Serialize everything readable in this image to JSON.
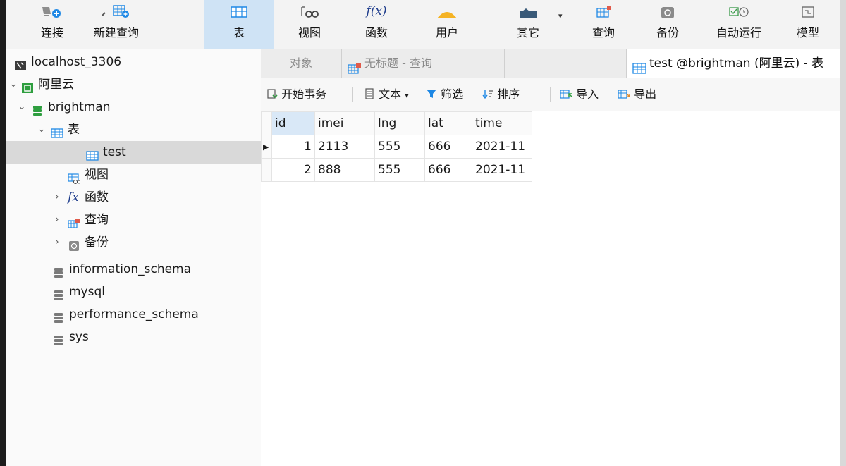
{
  "toolbar": {
    "connect": "连接",
    "new_query": "新建查询",
    "table": "表",
    "view": "视图",
    "function": "函数",
    "user": "用户",
    "others": "其它",
    "query": "查询",
    "backup": "备份",
    "auto_run": "自动运行",
    "model": "模型",
    "function_icon_text": "f(x)",
    "active_item": "table"
  },
  "sidebar": {
    "connection": "localhost_3306",
    "aliyun": "阿里云",
    "database": "brightman",
    "tables_folder": "表",
    "table_test": "test",
    "views": "视图",
    "functions": "函数",
    "function_icon_text": "fx",
    "queries": "查询",
    "backups": "备份",
    "other_dbs": [
      "information_schema",
      "mysql",
      "performance_schema",
      "sys"
    ]
  },
  "tabs": {
    "objects": "对象",
    "untitled_query": "无标题 - 查询",
    "active": "test @brightman (阿里云) - 表"
  },
  "subtoolbar": {
    "begin_transaction": "开始事务",
    "text": "文本",
    "filter": "筛选",
    "sort": "排序",
    "import": "导入",
    "export": "导出"
  },
  "grid": {
    "columns": [
      "id",
      "imei",
      "lng",
      "lat",
      "time"
    ],
    "rows": [
      [
        "1",
        "2113",
        "555",
        "666",
        "2021-11"
      ],
      [
        "2",
        "888",
        "555",
        "666",
        "2021-11"
      ]
    ]
  },
  "colors": {
    "accent": "#1e88e5",
    "active_toolbar": "#cfe3f5",
    "selection": "#d9d9d9",
    "database_green": "#2e9e3f"
  }
}
